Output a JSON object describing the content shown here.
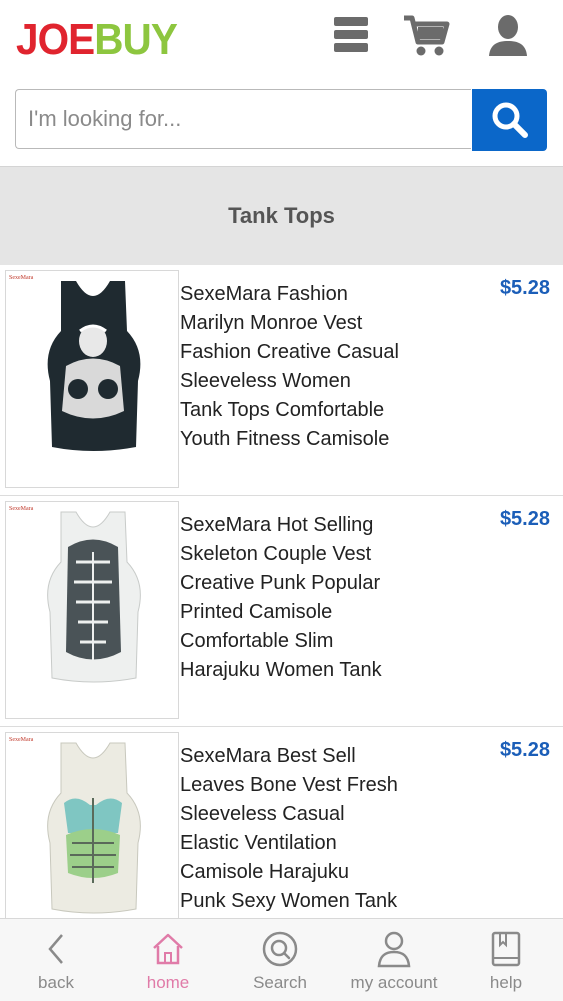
{
  "header": {
    "logo_part1": "JOE",
    "logo_part2": "BUY",
    "icons": [
      "menu-icon",
      "cart-icon",
      "user-icon"
    ]
  },
  "search": {
    "placeholder": "I'm looking for...",
    "value": "",
    "button_icon": "search-icon"
  },
  "category": {
    "title": "Tank Tops"
  },
  "products": [
    {
      "brand": "SexeMara",
      "title": "SexeMara Fashion\nMarilyn Monroe Vest\nFashion Creative Casual\nSleeveless Women\nTank Tops Comfortable\nYouth Fitness Camisole",
      "price": "$5.28"
    },
    {
      "brand": "SexeMara",
      "title": "SexeMara Hot Selling\nSkeleton Couple Vest\nCreative Punk Popular\nPrinted Camisole\nComfortable Slim\nHarajuku Women Tank",
      "price": "$5.28"
    },
    {
      "brand": "SexeMara",
      "title": "SexeMara Best Sell\nLeaves Bone Vest Fresh\nSleeveless Casual\nElastic Ventilation\nCamisole Harajuku\nPunk Sexy Women Tank",
      "price": "$5.28"
    }
  ],
  "bottom_nav": {
    "back": "back",
    "home": "home",
    "search": "Search",
    "account": "my account",
    "help": "help"
  },
  "colors": {
    "logo_red": "#e0242e",
    "logo_green": "#8dc63f",
    "search_button": "#0b67c9",
    "price_blue": "#1b5eb8",
    "home_active": "#e07ba8"
  }
}
